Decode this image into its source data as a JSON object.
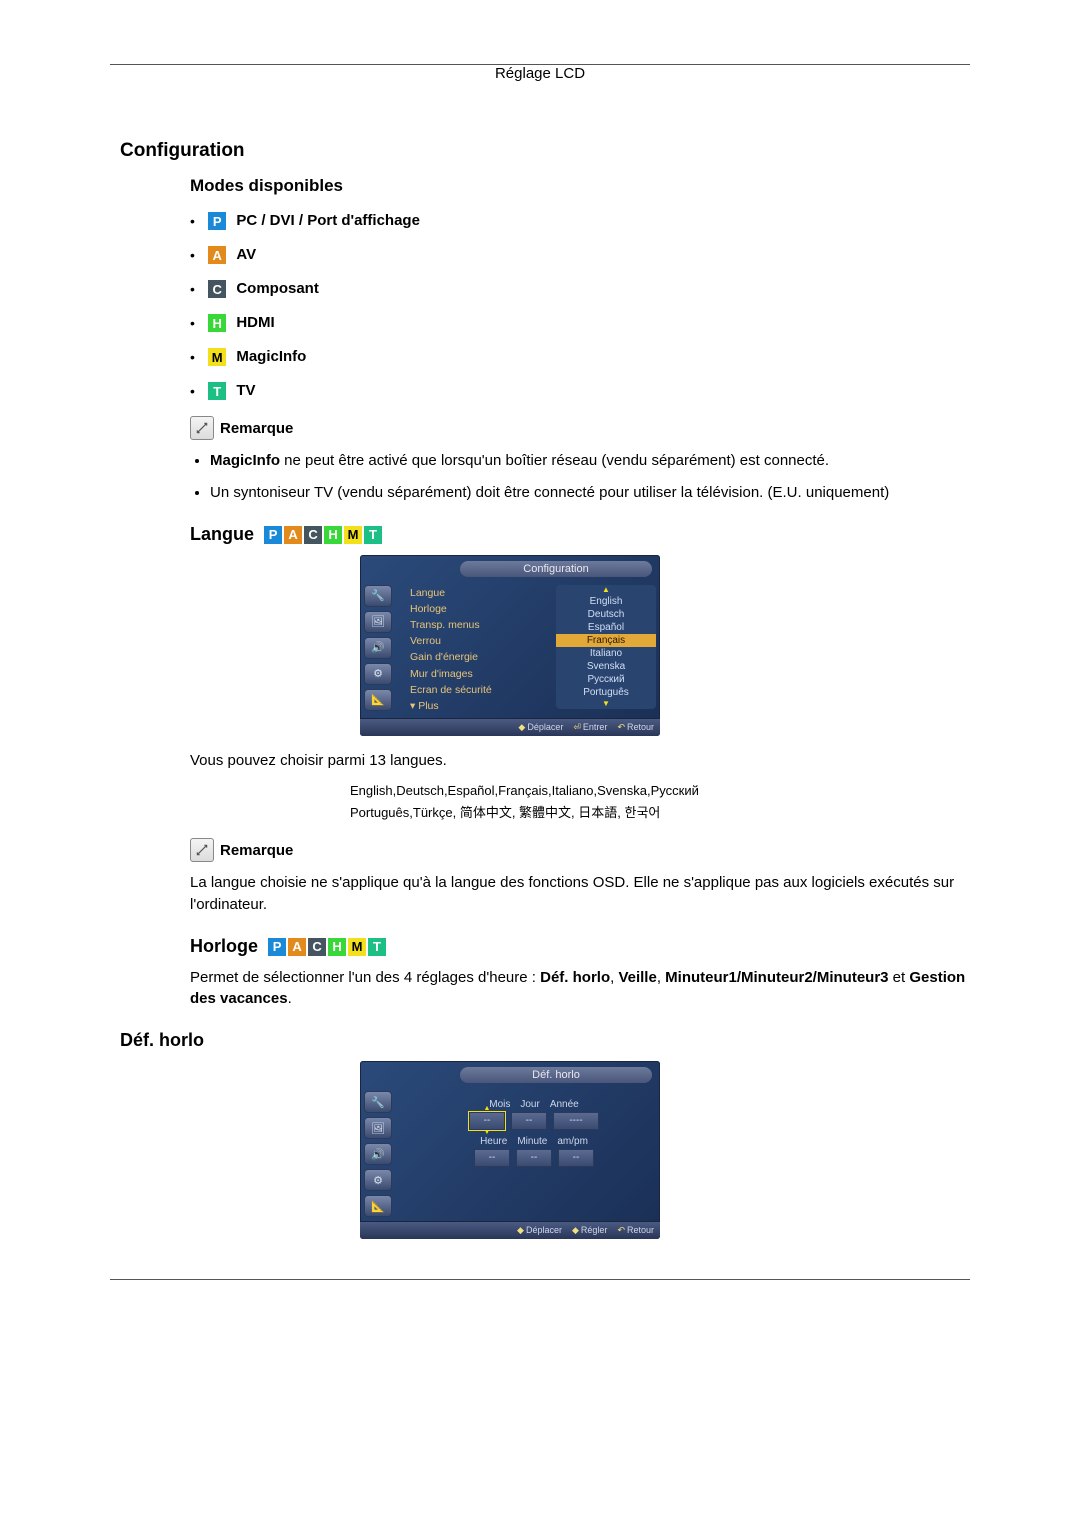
{
  "header": "Réglage LCD",
  "sections": {
    "config": "Configuration",
    "modes_title": "Modes disponibles",
    "modes": [
      {
        "badge": "P",
        "label": "PC / DVI / Port d'affichage"
      },
      {
        "badge": "A",
        "label": "AV"
      },
      {
        "badge": "C",
        "label": "Composant"
      },
      {
        "badge": "H",
        "label": "HDMI"
      },
      {
        "badge": "M",
        "label": "MagicInfo"
      },
      {
        "badge": "T",
        "label": "TV"
      }
    ],
    "remarque_label": "Remarque",
    "notes1": [
      "MagicInfo ne peut être activé que lorsqu'un boîtier réseau (vendu séparément) est connecté.",
      "Un syntoniseur TV (vendu séparément) doit être connecté pour utiliser la télévision. (E.U. uniquement)"
    ],
    "langue": {
      "title": "Langue",
      "osd_title": "Configuration",
      "menu_items": [
        "Langue",
        "Horloge",
        "Transp. menus",
        "Verrou",
        "Gain d'énergie",
        "Mur d'images",
        "Ecran de sécurité",
        "▾ Plus"
      ],
      "options": [
        "English",
        "Deutsch",
        "Español",
        "Français",
        "Italiano",
        "Svenska",
        "Русский",
        "Português"
      ],
      "selected": "Français",
      "footer": {
        "move": "Déplacer",
        "enter": "Entrer",
        "return": "Retour"
      },
      "caption": "Vous pouvez choisir parmi 13 langues.",
      "langs_line1": "English,Deutsch,Español,Français,Italiano,Svenska,Русский",
      "langs_line2": "Português,Türkçe, 简体中文, 繁體中文, 日本語, 한국어",
      "note": "La langue choisie ne s'applique qu'à la langue des fonctions OSD. Elle ne s'applique pas aux logiciels exécutés sur l'ordinateur."
    },
    "horloge": {
      "title": "Horloge",
      "intro": "Permet de sélectionner l'un des 4 réglages d'heure : Déf. horlo, Veille, Minuteur1/Minuteur2/Minuteur3 et Gestion des vacances.",
      "def_title": "Déf. horlo",
      "osd_title": "Déf. horlo",
      "row1_labels": [
        "Mois",
        "Jour",
        "Année"
      ],
      "row1_values": [
        "--",
        "--",
        "----"
      ],
      "row2_labels": [
        "Heure",
        "Minute",
        "am/pm"
      ],
      "row2_values": [
        "--",
        "--",
        "--"
      ],
      "footer": {
        "move": "Déplacer",
        "adjust": "Régler",
        "return": "Retour"
      }
    }
  }
}
